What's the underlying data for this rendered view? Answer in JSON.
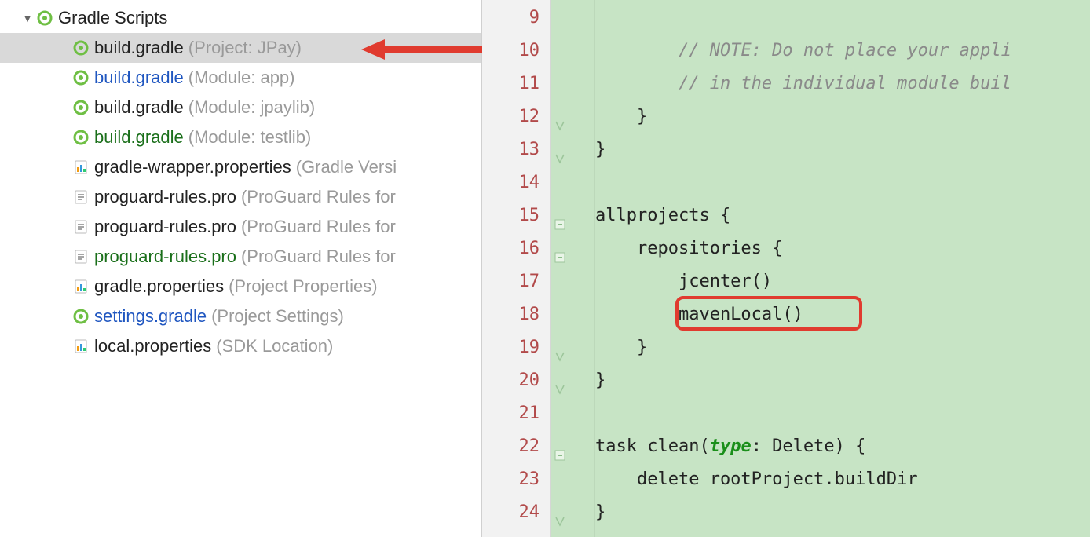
{
  "sidebar": {
    "root_label": "Gradle Scripts",
    "items": [
      {
        "icon": "gradle",
        "name": "build.gradle",
        "style": "black",
        "context": "(Project: JPay)",
        "selected": true
      },
      {
        "icon": "gradle",
        "name": "build.gradle",
        "style": "gradle-module",
        "context": "(Module: app)",
        "selected": false
      },
      {
        "icon": "gradle",
        "name": "build.gradle",
        "style": "black",
        "context": "(Module: jpaylib)",
        "selected": false
      },
      {
        "icon": "gradle",
        "name": "build.gradle",
        "style": "gradle",
        "context": "(Module: testlib)",
        "selected": false
      },
      {
        "icon": "props-color",
        "name": "gradle-wrapper.properties",
        "style": "black",
        "context": "(Gradle Versi",
        "selected": false
      },
      {
        "icon": "text",
        "name": "proguard-rules.pro",
        "style": "black",
        "context": "(ProGuard Rules for",
        "selected": false
      },
      {
        "icon": "text",
        "name": "proguard-rules.pro",
        "style": "black",
        "context": "(ProGuard Rules for",
        "selected": false
      },
      {
        "icon": "text",
        "name": "proguard-rules.pro",
        "style": "gradle",
        "context": "(ProGuard Rules for",
        "selected": false
      },
      {
        "icon": "props-color",
        "name": "gradle.properties",
        "style": "black",
        "context": "(Project Properties)",
        "selected": false
      },
      {
        "icon": "gradle",
        "name": "settings.gradle",
        "style": "settings",
        "context": "(Project Settings)",
        "selected": false
      },
      {
        "icon": "props-color",
        "name": "local.properties",
        "style": "black",
        "context": "(SDK Location)",
        "selected": false
      }
    ]
  },
  "editor": {
    "first_line_number": 9,
    "lines": [
      {
        "n": 9,
        "fold": "none",
        "tokens": [
          [
            "",
            ""
          ]
        ]
      },
      {
        "n": 10,
        "fold": "none",
        "tokens": [
          [
            "plain",
            "        "
          ],
          [
            "comment",
            "// NOTE: Do not place your appli"
          ]
        ]
      },
      {
        "n": 11,
        "fold": "none",
        "tokens": [
          [
            "plain",
            "        "
          ],
          [
            "comment",
            "// in the individual module buil"
          ]
        ]
      },
      {
        "n": 12,
        "fold": "close",
        "tokens": [
          [
            "plain",
            "    }"
          ]
        ]
      },
      {
        "n": 13,
        "fold": "close",
        "tokens": [
          [
            "plain",
            "}"
          ]
        ]
      },
      {
        "n": 14,
        "fold": "none",
        "tokens": [
          [
            "plain",
            ""
          ]
        ]
      },
      {
        "n": 15,
        "fold": "open",
        "tokens": [
          [
            "plain",
            "allprojects {"
          ]
        ]
      },
      {
        "n": 16,
        "fold": "open",
        "tokens": [
          [
            "plain",
            "    repositories {"
          ]
        ]
      },
      {
        "n": 17,
        "fold": "none",
        "tokens": [
          [
            "plain",
            "        jcenter()"
          ]
        ]
      },
      {
        "n": 18,
        "fold": "none",
        "tokens": [
          [
            "plain",
            "        mavenLocal()"
          ]
        ],
        "highlight": true
      },
      {
        "n": 19,
        "fold": "close",
        "tokens": [
          [
            "plain",
            "    }"
          ]
        ]
      },
      {
        "n": 20,
        "fold": "close",
        "tokens": [
          [
            "plain",
            "}"
          ]
        ]
      },
      {
        "n": 21,
        "fold": "none",
        "tokens": [
          [
            "plain",
            ""
          ]
        ]
      },
      {
        "n": 22,
        "fold": "open",
        "tokens": [
          [
            "plain",
            "task clean("
          ],
          [
            "keyword",
            "type"
          ],
          [
            "plain",
            ": Delete) {"
          ]
        ]
      },
      {
        "n": 23,
        "fold": "none",
        "tokens": [
          [
            "plain",
            "    delete rootProject.buildDir"
          ]
        ]
      },
      {
        "n": 24,
        "fold": "close",
        "tokens": [
          [
            "plain",
            "}"
          ]
        ]
      }
    ]
  }
}
